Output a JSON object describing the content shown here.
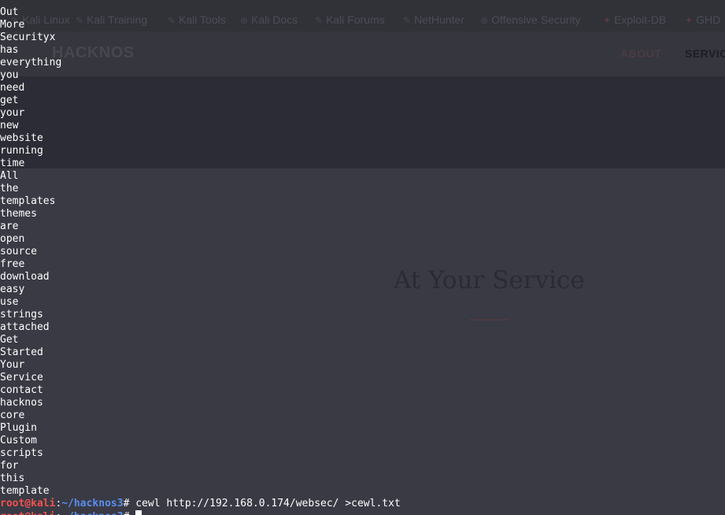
{
  "browser": {
    "bookmarks": [
      {
        "label": "Kali Linux",
        "icon": "kali-dragon-icon"
      },
      {
        "label": "Kali Training",
        "icon": "kali-dragon-icon"
      },
      {
        "label": "Kali Tools",
        "icon": "kali-dragon-icon"
      },
      {
        "label": "Kali Docs",
        "icon": "globe-icon"
      },
      {
        "label": "Kali Forums",
        "icon": "kali-dragon-icon"
      },
      {
        "label": "NetHunter",
        "icon": "kali-dragon-icon"
      },
      {
        "label": "Offensive Security",
        "icon": "globe-icon"
      },
      {
        "label": "Exploit-DB",
        "icon": "exploit-db-icon"
      },
      {
        "label": "GHD",
        "icon": "exploit-db-icon"
      }
    ],
    "site": {
      "brand": "HACKNOS",
      "nav": [
        "ABOUT",
        "SERVIC"
      ],
      "section_title": "At Your Service"
    }
  },
  "terminal": {
    "output": [
      "Out",
      "More",
      "Securityx",
      "has",
      "everything",
      "you",
      "need",
      "get",
      "your",
      "new",
      "website",
      "running",
      "time",
      "All",
      "the",
      "templates",
      "themes",
      "are",
      "open",
      "source",
      "free",
      "download",
      "easy",
      "use",
      "strings",
      "attached",
      "Get",
      "Started",
      "Your",
      "Service",
      "contact",
      "hacknos",
      "core",
      "Plugin",
      "Custom",
      "scripts",
      "for",
      "this",
      "template"
    ],
    "prompt": {
      "user": "root@kali",
      "sep": ":",
      "path": "~/hacknos3",
      "hash": "# ",
      "command": "cewl http://192.168.0.174/websec/ >cewl.txt"
    },
    "colors": {
      "user": "#f0524f",
      "path": "#5c8df0",
      "text": "#ffffff",
      "background": "#3b3c46"
    }
  }
}
